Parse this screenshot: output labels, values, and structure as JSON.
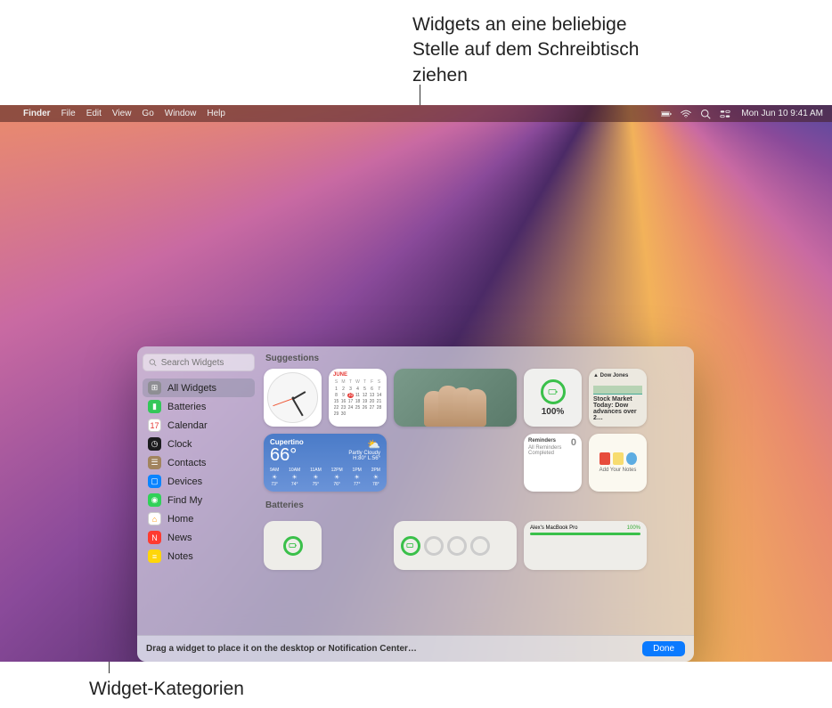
{
  "callouts": {
    "top": "Widgets an eine beliebige Stelle auf dem Schreibtisch ziehen",
    "bottom": "Widget-Kategorien"
  },
  "menubar": {
    "app": "Finder",
    "items": [
      "File",
      "Edit",
      "View",
      "Go",
      "Window",
      "Help"
    ],
    "datetime": "Mon Jun 10  9:41 AM"
  },
  "gallery": {
    "search_placeholder": "Search Widgets",
    "sidebar": [
      {
        "label": "All Widgets",
        "color": "#8e8e93",
        "glyph": "⊞",
        "selected": true
      },
      {
        "label": "Batteries",
        "color": "#34c759",
        "glyph": "▮"
      },
      {
        "label": "Calendar",
        "color": "#ffffff",
        "glyph": "17",
        "text": "#e53935"
      },
      {
        "label": "Clock",
        "color": "#1c1c1e",
        "glyph": "◷"
      },
      {
        "label": "Contacts",
        "color": "#a2845e",
        "glyph": "☰"
      },
      {
        "label": "Devices",
        "color": "#0a84ff",
        "glyph": "▢"
      },
      {
        "label": "Find My",
        "color": "#30d158",
        "glyph": "◉"
      },
      {
        "label": "Home",
        "color": "#ffffff",
        "glyph": "⌂",
        "text": "#ff9500"
      },
      {
        "label": "News",
        "color": "#ff3b30",
        "glyph": "N"
      },
      {
        "label": "Notes",
        "color": "#ffd60a",
        "glyph": "≡"
      }
    ],
    "sections": {
      "suggestions": "Suggestions",
      "batteries": "Batteries"
    },
    "calendar": {
      "month": "JUNE",
      "dow": [
        "S",
        "M",
        "T",
        "W",
        "T",
        "F",
        "S"
      ],
      "today": 10
    },
    "weather": {
      "location": "Cupertino",
      "temp": "66°",
      "condition": "Partly Cloudy",
      "hilo": "H:80° L:56°",
      "hours": [
        {
          "t": "9AM",
          "d": "73°"
        },
        {
          "t": "10AM",
          "d": "74°"
        },
        {
          "t": "11AM",
          "d": "75°"
        },
        {
          "t": "12PM",
          "d": "76°"
        },
        {
          "t": "1PM",
          "d": "77°"
        },
        {
          "t": "2PM",
          "d": "78°"
        }
      ]
    },
    "battery": {
      "percent": "100%"
    },
    "stocks": {
      "symbol": "▲ Dow Jones",
      "headline": "Stock Market Today: Dow advances over 2…"
    },
    "reminders": {
      "title": "Reminders",
      "line": "All Reminders Completed",
      "count": "0"
    },
    "notes": {
      "caption": "Add Your Notes"
    },
    "battery_list": {
      "device": "Alex's MacBook Pro",
      "pct": "100%"
    },
    "footer_hint": "Drag a widget to place it on the desktop or Notification Center…",
    "done": "Done"
  }
}
